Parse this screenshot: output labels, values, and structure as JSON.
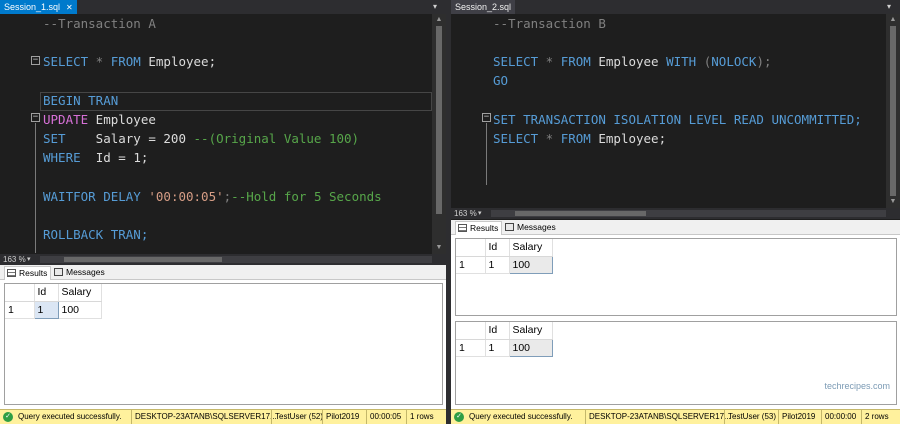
{
  "session_a": {
    "tab_title": "Session_1.sql",
    "tab_close": "✕",
    "tab_menu": "▾",
    "zoom": "163 %",
    "code": {
      "l1": "--Transaction A",
      "l2_kw1": "SELECT",
      "l2_star": " * ",
      "l2_kw2": "FROM",
      "l2_rest": " Employee;",
      "l3": "BEGIN TRAN",
      "l4_kw": "UPDATE",
      "l4_rest": " Employee",
      "l5_kw": "SET",
      "l5_rest": "    Salary = 200 ",
      "l5_cm": "--(Original Value 100)",
      "l6_kw": "WHERE",
      "l6_rest": "  Id = 1;",
      "l7_kw": "WAITFOR DELAY",
      "l7_str": " '00:00:05'",
      "l7_semi": ";",
      "l7_cm": "--Hold for 5 Seconds",
      "l8": "ROLLBACK TRAN;"
    },
    "results_tab": "Results",
    "messages_tab": "Messages",
    "grids": [
      {
        "headers": [
          "",
          "Id",
          "Salary"
        ],
        "rows": [
          [
            "1",
            "1",
            "100"
          ]
        ]
      }
    ],
    "status": {
      "message": "Query executed successfully.",
      "server": "DESKTOP-23ATANB\\SQLSERVER17...",
      "user": "TestUser (52)",
      "database": "Pilot2019",
      "elapsed": "00:00:05",
      "rows": "1 rows"
    }
  },
  "session_b": {
    "tab_title": "Session_2.sql",
    "tab_close": "✕",
    "tab_menu": "▾",
    "zoom": "163 %",
    "code": {
      "l1": "--Transaction B",
      "l2_kw1": "SELECT",
      "l2_star": " * ",
      "l2_kw2": "FROM",
      "l2_mid": " Employee ",
      "l2_kw3": "WITH",
      "l2_paren": " (",
      "l2_kw4": "NOLOCK",
      "l2_end": ");",
      "l3": "GO",
      "l4": "SET TRANSACTION ISOLATION LEVEL READ UNCOMMITTED;",
      "l5_kw1": "SELECT",
      "l5_star": " * ",
      "l5_kw2": "FROM",
      "l5_rest": " Employee;"
    },
    "results_tab": "Results",
    "messages_tab": "Messages",
    "grids": [
      {
        "headers": [
          "",
          "Id",
          "Salary"
        ],
        "rows": [
          [
            "1",
            "1",
            "100"
          ]
        ]
      },
      {
        "headers": [
          "",
          "Id",
          "Salary"
        ],
        "rows": [
          [
            "1",
            "1",
            "100"
          ]
        ]
      }
    ],
    "status": {
      "message": "Query executed successfully.",
      "server": "DESKTOP-23ATANB\\SQLSERVER17...",
      "user": "TestUser (53)",
      "database": "Pilot2019",
      "elapsed": "00:00:00",
      "rows": "2 rows"
    }
  },
  "watermark": "techrecipes.com",
  "colors": {
    "keyword": "#569cd6",
    "comment": "#57a64a",
    "string": "#d69d85",
    "status_bar": "#fff19d",
    "active_tab": "#007acc"
  }
}
